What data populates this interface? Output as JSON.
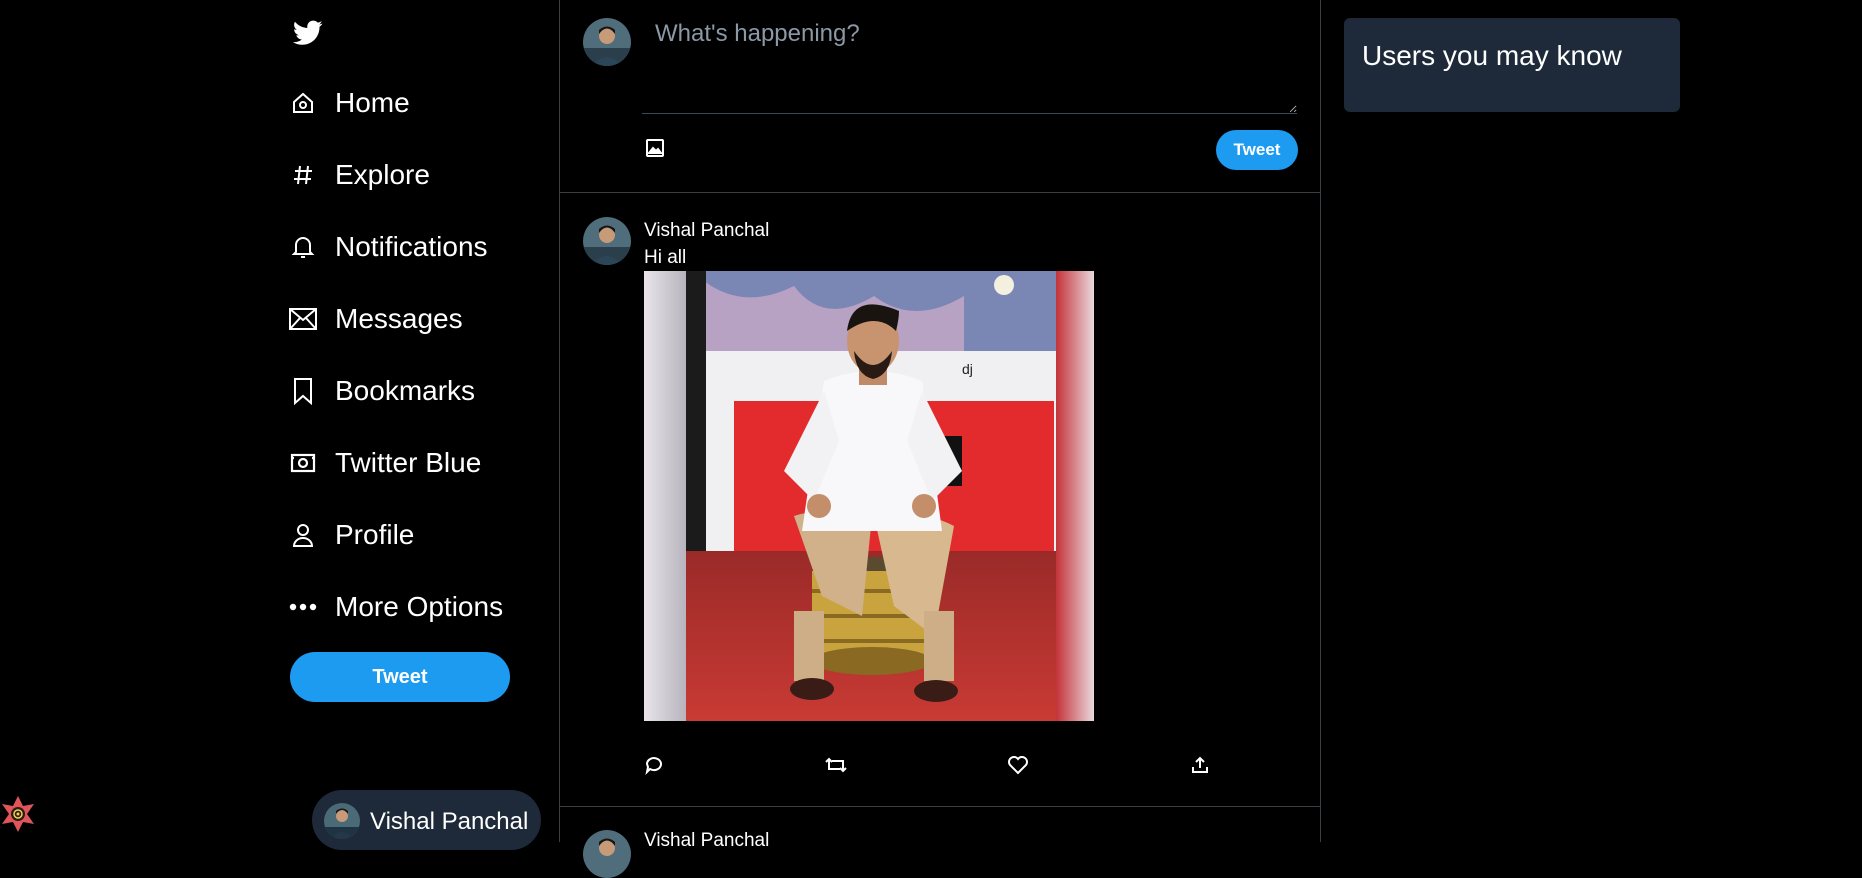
{
  "sidebar": {
    "logo_icon": "twitter-bird-icon",
    "items": [
      {
        "label": "Home",
        "icon": "home-icon"
      },
      {
        "label": "Explore",
        "icon": "hash-icon"
      },
      {
        "label": "Notifications",
        "icon": "bell-icon"
      },
      {
        "label": "Messages",
        "icon": "envelope-icon"
      },
      {
        "label": "Bookmarks",
        "icon": "bookmark-icon"
      },
      {
        "label": "Twitter Blue",
        "icon": "money-icon"
      },
      {
        "label": "Profile",
        "icon": "person-icon"
      },
      {
        "label": "More Options",
        "icon": "more-dots-icon"
      }
    ],
    "tweet_button_label": "Tweet",
    "current_user_name": "Vishal Panchal"
  },
  "composer": {
    "placeholder": "What's happening?",
    "tweet_button_label": "Tweet"
  },
  "feed": {
    "posts": [
      {
        "author": "Vishal Panchal",
        "text": "Hi all"
      },
      {
        "author": "Vishal Panchal"
      }
    ]
  },
  "right": {
    "suggestions_title": "Users you may know"
  },
  "colors": {
    "accent": "#1d9bf0",
    "panel": "#1e2a3a",
    "border": "#3a3f45",
    "background": "#000000"
  }
}
